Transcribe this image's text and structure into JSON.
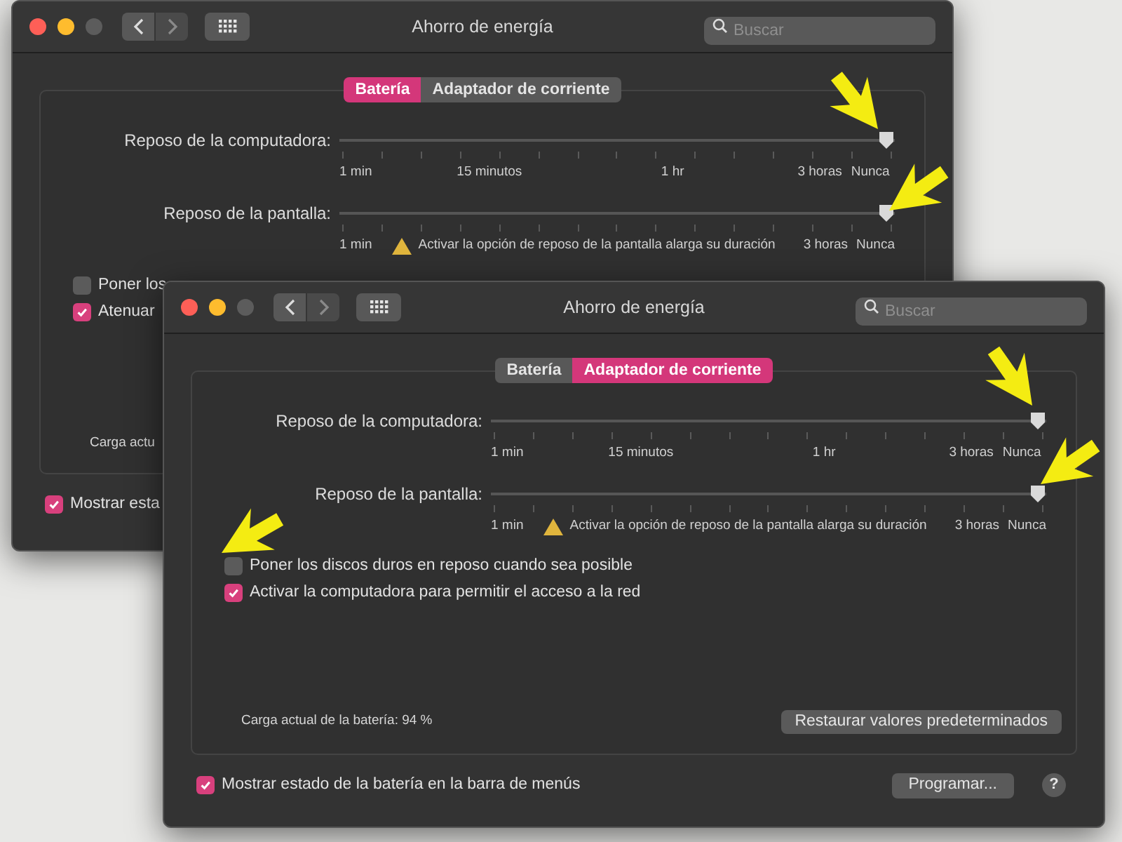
{
  "windows": [
    {
      "title": "Ahorro de energía",
      "search": {
        "placeholder": "Buscar"
      },
      "tabs": [
        {
          "label": "Batería",
          "selected": true
        },
        {
          "label": "Adaptador de corriente",
          "selected": false
        }
      ],
      "sliders": [
        {
          "label": "Reposo de la computadora:",
          "level": 1,
          "tick_labels": [
            "1 min",
            "15 minutos",
            "1 hr",
            "3 horas",
            "Nunca"
          ]
        },
        {
          "label": "Reposo de la pantalla:",
          "level": 1,
          "tick_labels": [
            "1 min",
            "3 horas",
            "Nunca"
          ],
          "note": "Activar la opción de reposo de la pantalla alarga su duración"
        }
      ],
      "options": [
        {
          "label": "Poner los",
          "checked": false
        },
        {
          "label": "Atenuar",
          "checked": true
        }
      ],
      "battery_charge": "Carga actu",
      "menu_bar_option": {
        "label": "Mostrar esta",
        "checked": true
      }
    },
    {
      "title": "Ahorro de energía",
      "search": {
        "placeholder": "Buscar"
      },
      "tabs": [
        {
          "label": "Batería",
          "selected": false
        },
        {
          "label": "Adaptador de corriente",
          "selected": true
        }
      ],
      "sliders": [
        {
          "label": "Reposo de la computadora:",
          "level": 1,
          "tick_labels": [
            "1 min",
            "15 minutos",
            "1 hr",
            "3 horas",
            "Nunca"
          ]
        },
        {
          "label": "Reposo de la pantalla:",
          "level": 1,
          "tick_labels": [
            "1 min",
            "3 horas",
            "Nunca"
          ],
          "note": "Activar la opción de reposo de la pantalla alarga su duración"
        }
      ],
      "options": [
        {
          "label": "Poner los discos duros en reposo cuando sea posible",
          "checked": false
        },
        {
          "label": "Activar la computadora para permitir el acceso a la red",
          "checked": true
        }
      ],
      "battery_charge": "Carga actual de la batería: 94 %",
      "restore_button": "Restaurar valores predeterminados",
      "menu_bar_option": {
        "label": "Mostrar estado de la batería en la barra de menús",
        "checked": true
      },
      "schedule_button": "Programar...",
      "help_button": "?"
    }
  ]
}
